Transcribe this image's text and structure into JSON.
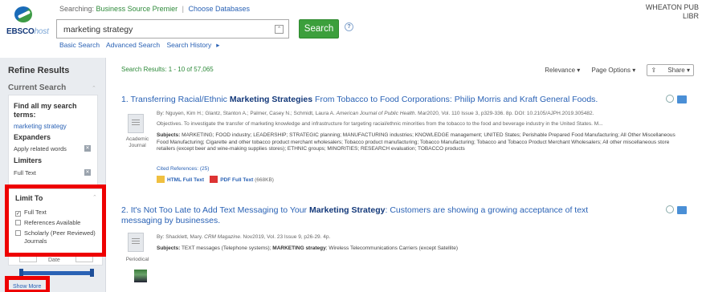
{
  "header": {
    "logo_main": "EBSCO",
    "logo_sub": "host",
    "searching_prefix": "Searching:",
    "database": "Business Source Premier",
    "choose_databases": "Choose Databases",
    "search_value": "marketing strategy",
    "search_button": "Search",
    "basic_search": "Basic Search",
    "advanced_search": "Advanced Search",
    "search_history": "Search History",
    "institution_line1": "WHEATON PUB",
    "institution_line2": "LIBR"
  },
  "sidebar": {
    "refine_results": "Refine Results",
    "current_search": "Current Search",
    "find_all_terms": "Find all my search terms:",
    "search_term": "marketing strategy",
    "expanders": "Expanders",
    "apply_related": "Apply related words",
    "limiters": "Limiters",
    "full_text": "Full Text",
    "limit_to": "Limit To",
    "limit_options": [
      {
        "label": "Full Text",
        "checked": true
      },
      {
        "label": "References Available",
        "checked": false
      },
      {
        "label": "Scholarly (Peer Reviewed)",
        "checked": false
      },
      {
        "label": "Journals",
        "checked": false
      }
    ],
    "date_label": "Date",
    "show_more": "Show More"
  },
  "main": {
    "results_count": "Search Results: 1 - 10 of 57,065",
    "relevance": "Relevance ▾",
    "page_options": "Page Options ▾",
    "share": "Share ▾"
  },
  "results": [
    {
      "number": "1.",
      "title_pre": "Transferring Racial/Ethnic ",
      "title_bold": "Marketing Strategies",
      "title_post": " From Tobacco to Food Corporations: Philip Morris and Kraft General Foods.",
      "byline": "By: Nguyen, Kim H.; Glantz, Stanton A.; Palmer, Casey N.; Schmidt, Laura A.",
      "journal": "American Journal of Public Health",
      "details": ". Mar2020, Vol. 110 Issue 3, p329-336. 8p. DOI: 10.2105/AJPH.2019.305482.",
      "abstract": "Objectives. To investigate the transfer of marketing knowledge and infrastructure for targeting racial/ethnic minorities from the tobacco to the food and beverage industry in the United States. M...",
      "doc_type_1": "Academic",
      "doc_type_2": "Journal",
      "subjects_label": "Subjects:",
      "subjects": " MARKETING; FOOD industry; LEADERSHIP; STRATEGIC planning; MANUFACTURING industries; KNOWLEDGE management; UNITED States; Perishable Prepared Food Manufacturing; All Other Miscellaneous Food Manufacturing; Cigarette and other tobacco product merchant wholesalers; Tobacco product manufacturing; Tobacco Manufacturing; Tobacco and Tobacco Product Merchant Wholesalers; All other miscellaneous store retailers (except beer and wine-making supplies stores); ETHNIC groups; MINORITIES; RESEARCH evaluation; TOBACCO products",
      "cited": "Cited References: (25)",
      "html_full_text": "HTML Full Text",
      "pdf_full_text": "PDF Full Text",
      "pdf_size": "(668KB)"
    },
    {
      "number": "2.",
      "title_pre": "It's Not Too Late to Add Text Messaging to Your ",
      "title_bold": "Marketing Strategy",
      "title_post": ": Customers are showing a growing acceptance of text messaging by businesses.",
      "byline": "By: Shacklett, Mary.",
      "journal": "CRM Magazine",
      "details": ". Nov2019, Vol. 23 Issue 9, p26-29. 4p.",
      "doc_type_1": "Periodical",
      "subjects_label": "Subjects:",
      "subjects_pre": " TEXT messages (Telephone systems); ",
      "subjects_bold": "MARKETING strategy",
      "subjects_post": "; Wireless Telecommunications Carriers (except Satellite)"
    }
  ],
  "colors": {
    "link_blue": "#2a62b5",
    "search_green": "#3c9f3c",
    "highlight_red": "#ee0000",
    "sidebar_bg": "#e9ecf0"
  }
}
